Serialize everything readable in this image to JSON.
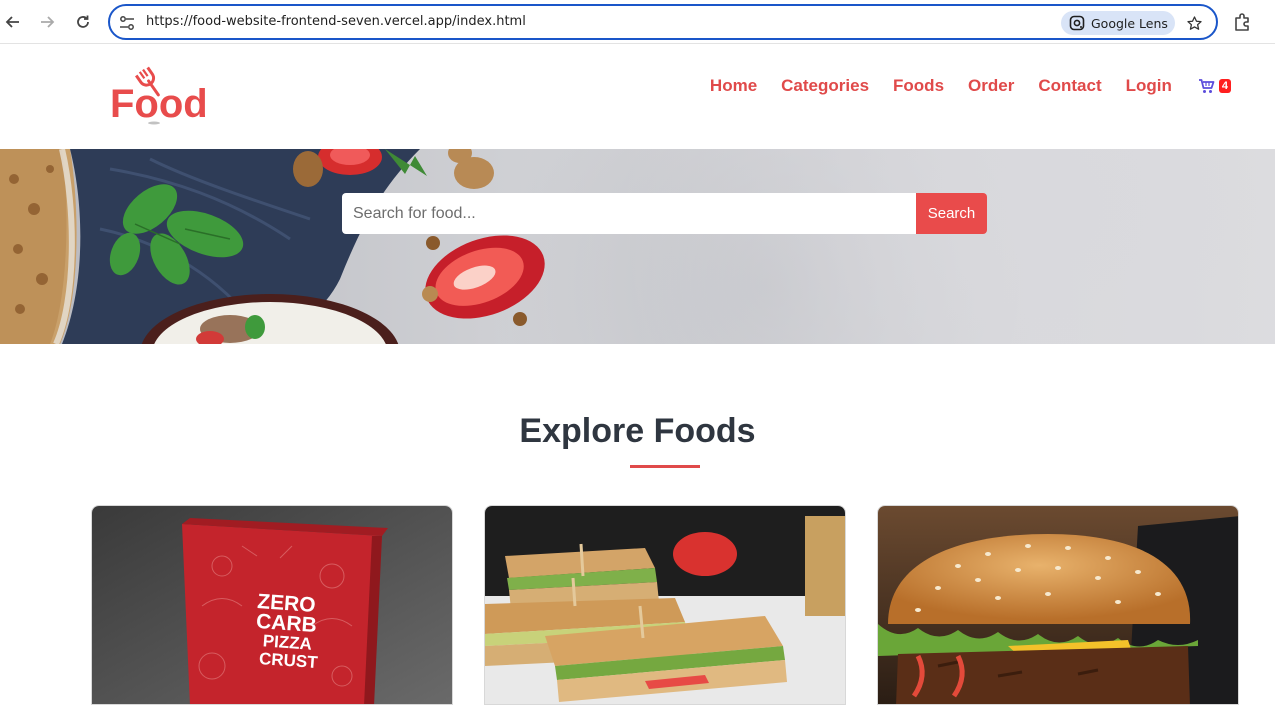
{
  "browser": {
    "url": "https://food-website-frontend-seven.vercel.app/index.html",
    "lens_label": "Google Lens",
    "icons": [
      "back-arrow-icon",
      "forward-arrow-icon",
      "reload-icon",
      "site-info-icon",
      "google-lens-icon",
      "bookmark-star-icon",
      "extensions-icon"
    ]
  },
  "site": {
    "logo_text": "Food",
    "nav": [
      {
        "label": "Home"
      },
      {
        "label": "Categories"
      },
      {
        "label": "Foods"
      },
      {
        "label": "Order"
      },
      {
        "label": "Contact"
      },
      {
        "label": "Login"
      }
    ],
    "cart_count": "4",
    "colors": {
      "brand": "#e04a4a",
      "cart_icon": "#5b4cdb",
      "badge": "#ff1f1f"
    }
  },
  "hero": {
    "search_placeholder": "Search for food...",
    "search_button": "Search"
  },
  "explore": {
    "title": "Explore Foods",
    "cards": [
      {
        "image": "pizza-box",
        "box_text": [
          "ZERO",
          "CARB",
          "PIZZA",
          "CRUST"
        ]
      },
      {
        "image": "sandwich"
      },
      {
        "image": "burger"
      }
    ]
  }
}
